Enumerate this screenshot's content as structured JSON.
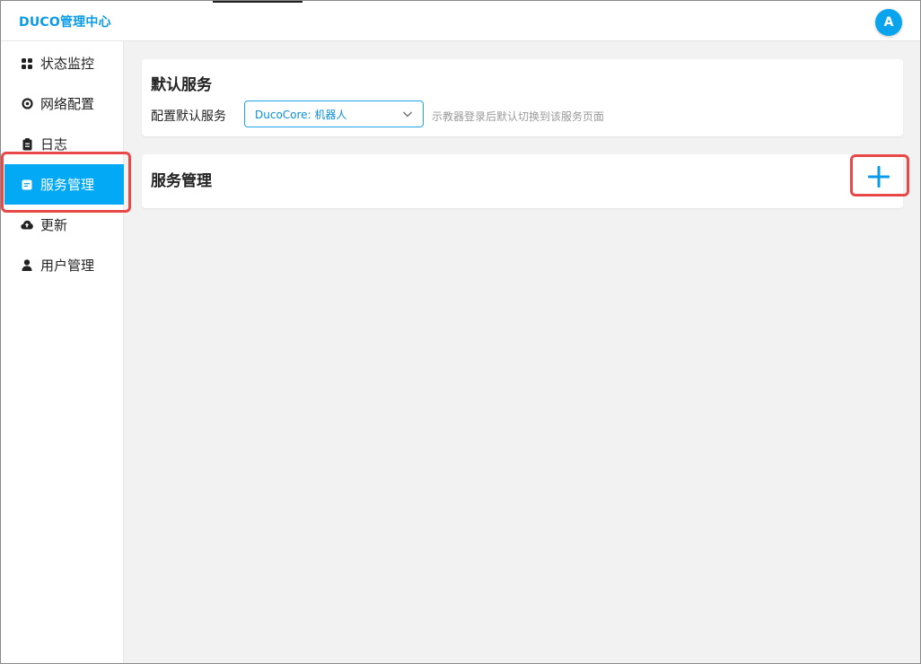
{
  "app": {
    "brand": "DUCO管理中心",
    "avatar_letter": "A"
  },
  "sidebar": {
    "items": [
      {
        "label": "状态监控",
        "icon": "dashboard-icon"
      },
      {
        "label": "网络配置",
        "icon": "target-icon"
      },
      {
        "label": "日志",
        "icon": "clipboard-icon"
      },
      {
        "label": "服务管理",
        "icon": "service-icon",
        "active": true
      },
      {
        "label": "更新",
        "icon": "cloud-icon"
      },
      {
        "label": "用户管理",
        "icon": "user-icon"
      }
    ]
  },
  "default_service": {
    "title": "默认服务",
    "label": "配置默认服务",
    "selected": "DucoCore: 机器人",
    "hint": "示教器登录后默认切换到该服务页面"
  },
  "service_management": {
    "title": "服务管理"
  },
  "colors": {
    "accent": "#03a9f4",
    "brand": "#0a9be8",
    "highlight": "#e84848",
    "background": "#f2f2f2"
  }
}
